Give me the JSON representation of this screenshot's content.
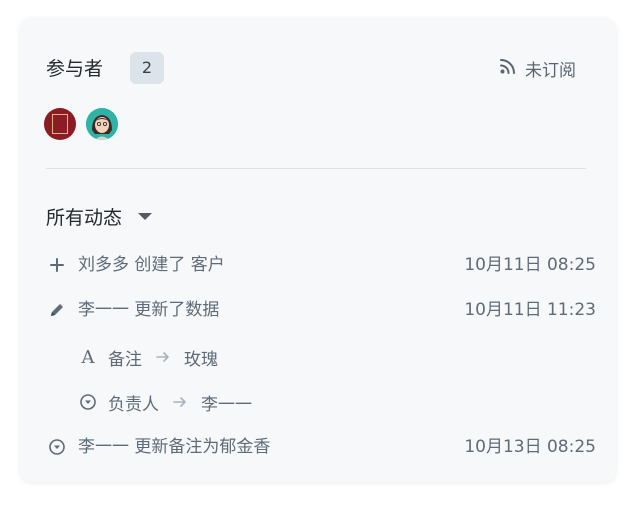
{
  "participants": {
    "title": "参与者",
    "count": "2",
    "subscribe_label": "未订阅",
    "avatars": [
      {
        "name": "avatar-red-seal",
        "color": "#8b1c24"
      },
      {
        "name": "avatar-teal-portrait",
        "color": "#2fb3a6"
      }
    ]
  },
  "activity": {
    "filter_label": "所有动态",
    "items": [
      {
        "icon": "plus-icon",
        "text": "刘多多 创建了 客户",
        "time": "10月11日 08:25"
      },
      {
        "icon": "pencil-icon",
        "text": "李一一 更新了数据",
        "time": "10月11日 11:23",
        "changes": [
          {
            "icon": "text-field-icon",
            "field": "备注",
            "value": "玫瑰"
          },
          {
            "icon": "dropdown-field-icon",
            "field": "负责人",
            "value": "李一一"
          }
        ]
      },
      {
        "icon": "dropdown-circle-icon",
        "text": "李一一 更新备注为郁金香",
        "time": "10月13日 08:25"
      }
    ]
  },
  "colors": {
    "card_bg": "#f7f8fa",
    "text_primary": "#24292f",
    "text_secondary": "#5f6b78",
    "badge_bg": "#dde3ea"
  }
}
